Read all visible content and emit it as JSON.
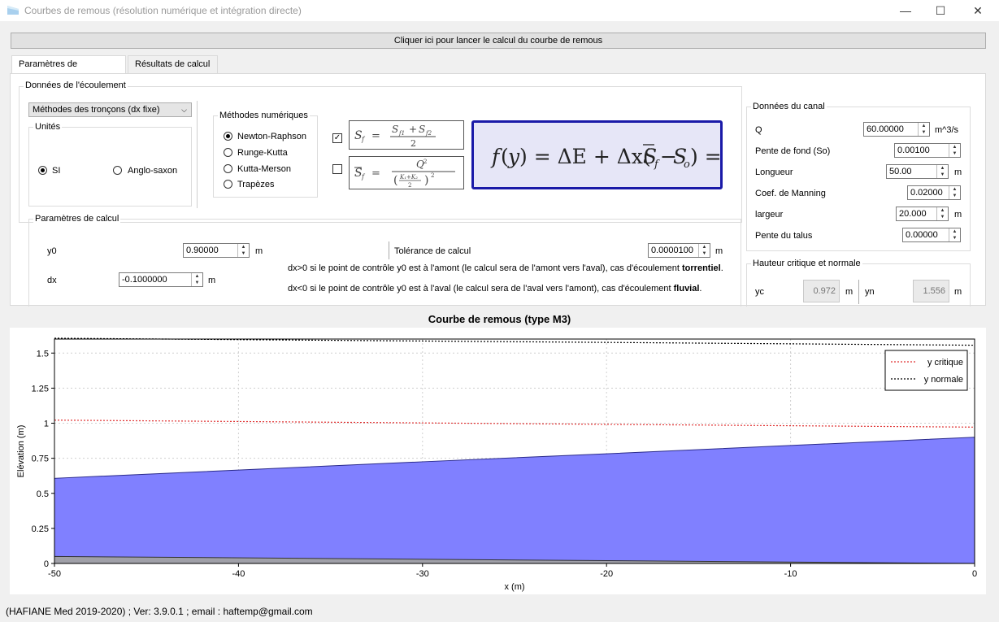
{
  "window": {
    "title": "Courbes de remous (résolution numérique et intégration directe)",
    "buttons": {
      "minimize": "—",
      "maximize": "☐",
      "close": "✕"
    }
  },
  "run_button": "Cliquer ici pour lancer le calcul du courbe de remous",
  "tabs": [
    {
      "label": "Paramètres de simulation",
      "active": true
    },
    {
      "label": "Résultats de calcul",
      "active": false
    }
  ],
  "flow_data": {
    "group_title": "Données de l'écoulement",
    "method_select": "Méthodes des tronçons (dx fixe)",
    "units": {
      "title": "Unités",
      "si": "SI",
      "anglo": "Anglo-saxon",
      "selected": "SI"
    },
    "numerical": {
      "title": "Méthodes numériques",
      "options": [
        "Newton-Raphson",
        "Runge-Kutta",
        "Kutta-Merson",
        "Trapèzes"
      ],
      "selected": "Newton-Raphson"
    },
    "formula_checked": [
      true,
      false
    ]
  },
  "calc_params": {
    "title": "Paramètres de calcul",
    "y0_label": "y0",
    "y0_value": "0.90000",
    "y0_unit": "m",
    "dx_label": "dx",
    "dx_value": "-0.1000000",
    "dx_unit": "m",
    "tol_label": "Tolérance de calcul",
    "tol_value": "0.0000100",
    "tol_unit": "m",
    "note1_prefix": "dx>0 si le point de contrôle y0 est à l'amont (le calcul sera de l'amont vers l'aval), cas d'écoulement ",
    "note1_bold": "torrentiel",
    "note1_suffix": ".",
    "note2_prefix": "dx<0 si le point de contrôle y0 est à l'aval (le calcul sera de l'aval vers l'amont), cas d'écoulement ",
    "note2_bold": "fluvial",
    "note2_suffix": "."
  },
  "canal": {
    "title": "Données du canal",
    "q_label": "Q",
    "q_value": "60.00000",
    "q_unit": "m^3/s",
    "slope_label": "Pente de fond (So)",
    "slope_value": "0.00100",
    "length_label": "Longueur",
    "length_value": "50.00",
    "length_unit": "m",
    "manning_label": "Coef. de Manning",
    "manning_value": "0.02000",
    "width_label": "largeur",
    "width_value": "20.000",
    "width_unit": "m",
    "talus_label": "Pente du talus",
    "talus_value": "0.00000"
  },
  "heights": {
    "title": "Hauteur critique et normale",
    "yc_label": "yc",
    "yc_value": "0.972",
    "yc_unit": "m",
    "yn_label": "yn",
    "yn_value": "1.556",
    "yn_unit": "m"
  },
  "chart_data": {
    "type": "area",
    "title": "Courbe de remous (type M3)",
    "xlabel": "x (m)",
    "ylabel": "Elévation (m)",
    "xlim": [
      -50,
      0
    ],
    "ylim": [
      0,
      1.6
    ],
    "xticks": [
      -50,
      -40,
      -30,
      -20,
      -10,
      0
    ],
    "yticks": [
      "0",
      "0.25",
      "0.5",
      "0.75",
      "1",
      "1.25",
      "1.5"
    ],
    "yticks_values": [
      0,
      0.25,
      0.5,
      0.75,
      1,
      1.25,
      1.5
    ],
    "grid": true,
    "legend_position": "top-right",
    "series": [
      {
        "name": "y critique",
        "style": "dotted",
        "color": "#e03030",
        "x": [
          -50,
          0
        ],
        "y": [
          1.022,
          0.972
        ]
      },
      {
        "name": "y normale",
        "style": "dotted",
        "color": "#000000",
        "x": [
          -50,
          0
        ],
        "y": [
          1.606,
          1.556
        ]
      },
      {
        "style": "area",
        "color": "#8080ff",
        "x": [
          -50,
          -40,
          -30,
          -20,
          -10,
          0
        ],
        "y": [
          0.607,
          0.666,
          0.725,
          0.782,
          0.841,
          0.9
        ]
      },
      {
        "style": "area",
        "color": "#a0a0a8",
        "x": [
          -50,
          0
        ],
        "y": [
          0.05,
          0
        ]
      }
    ]
  },
  "status": "(HAFIANE Med 2019-2020) ; Ver: 3.9.0.1 ; email : haftemp@gmail.com"
}
